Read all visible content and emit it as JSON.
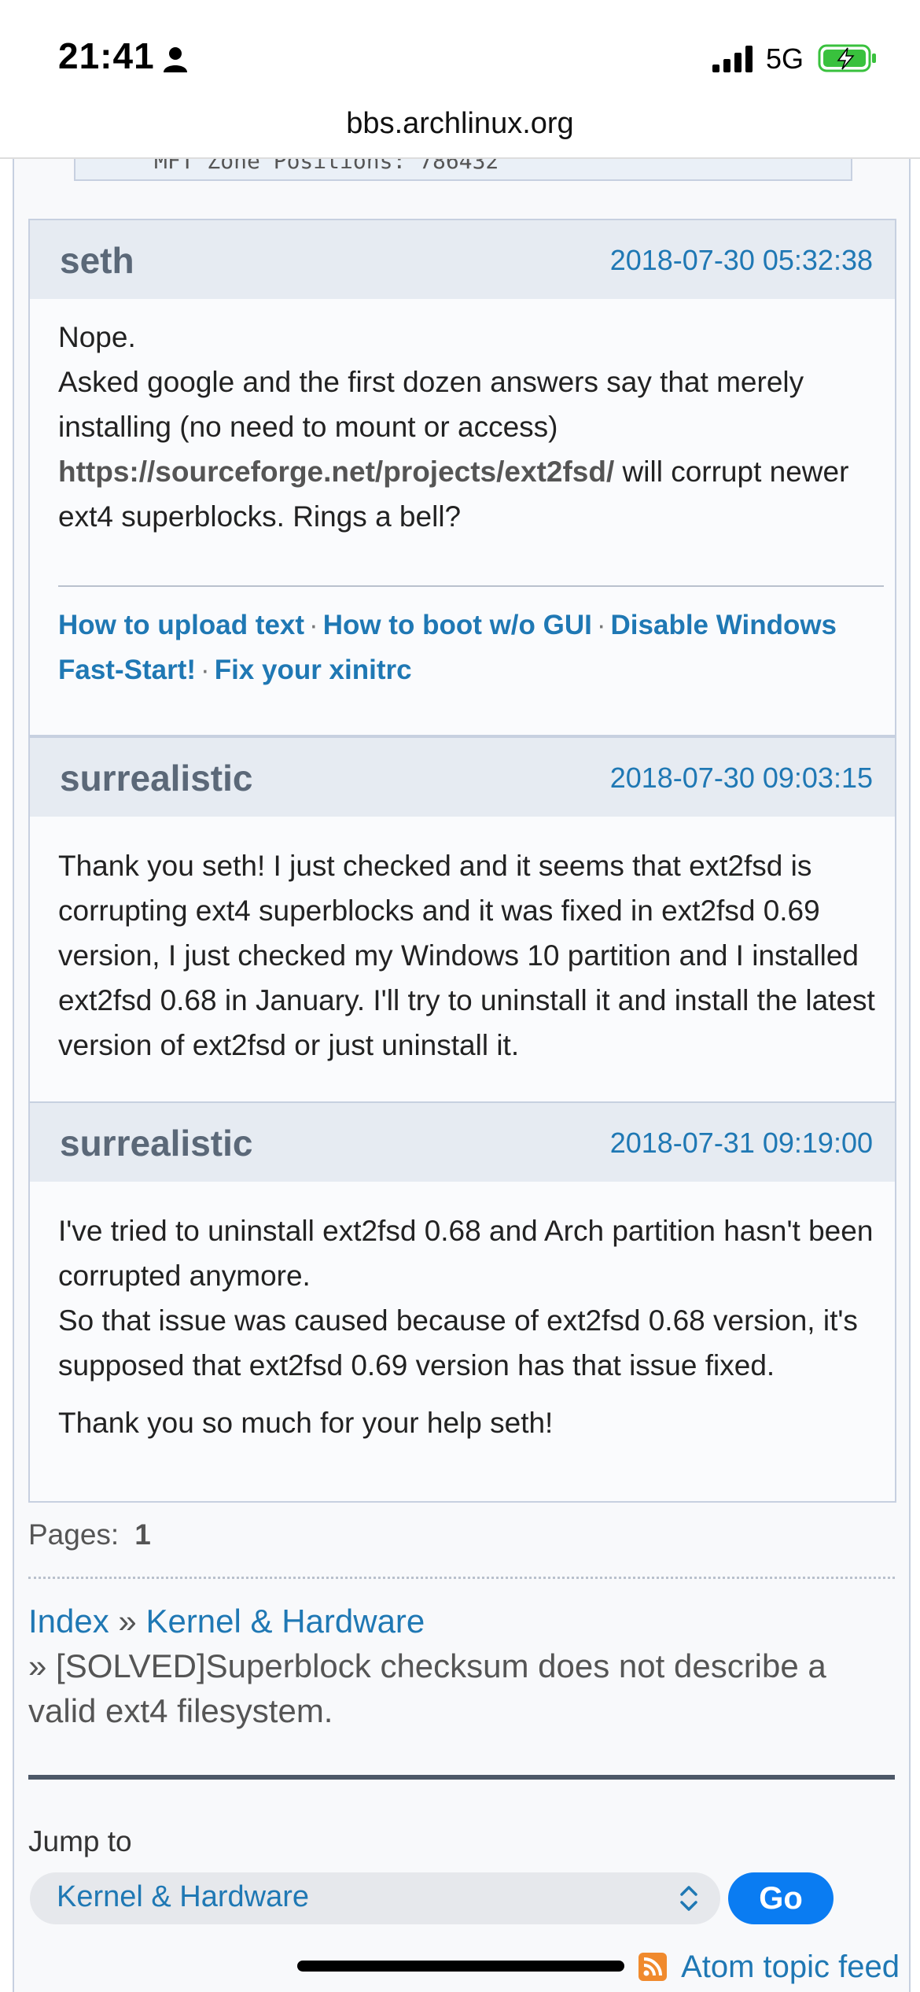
{
  "status_bar": {
    "time": "21:41",
    "network": "5G"
  },
  "browser": {
    "url": "bbs.archlinux.org"
  },
  "code_stub_text": "MFT Zone Positions: 786432",
  "posts": [
    {
      "author": "seth",
      "date": "2018-07-30 05:32:38",
      "lines": [
        "Nope.",
        "Asked google and the first dozen answers say that merely installing (no need to mount or access)"
      ],
      "link": "https://sourceforge.net/projects/ext2fsd/",
      "after_link": " will corrupt newer ext4 superblocks. Rings a bell?",
      "signature": [
        "How to upload text",
        "How to boot w/o GUI",
        "Disable Windows Fast-Start!",
        "Fix your xinitrc"
      ]
    },
    {
      "author": "surrealistic",
      "date": "2018-07-30 09:03:15",
      "text": "Thank you seth! I just checked and it seems that ext2fsd is corrupting ext4 superblocks and it was fixed in ext2fsd 0.69 version, I just checked my Windows 10 partition and I installed ext2fsd 0.68 in January. I'll try to uninstall it and install the latest version of ext2fsd or just uninstall it."
    },
    {
      "author": "surrealistic",
      "date": "2018-07-31 09:19:00",
      "p1": "I've tried to uninstall ext2fsd 0.68 and Arch partition hasn't been corrupted anymore.",
      "p2": "So that issue was caused because of ext2fsd 0.68 version, it's supposed that ext2fsd 0.69 version has that issue fixed.",
      "p3": "Thank you so much for your help seth!"
    }
  ],
  "pagination": {
    "label": "Pages:",
    "current": "1"
  },
  "breadcrumbs": {
    "index": "Index",
    "sep": "»",
    "forum": "Kernel & Hardware",
    "topic": "[SOLVED]Superblock checksum does not describe a valid ext4 filesystem."
  },
  "jump": {
    "label": "Jump to",
    "selected": "Kernel & Hardware",
    "go_label": "Go"
  },
  "feed": {
    "label": "Atom topic feed"
  },
  "colors": {
    "link": "#1f78b4",
    "go_button": "#0a7cf2",
    "header_bg": "#e6ebf2"
  }
}
